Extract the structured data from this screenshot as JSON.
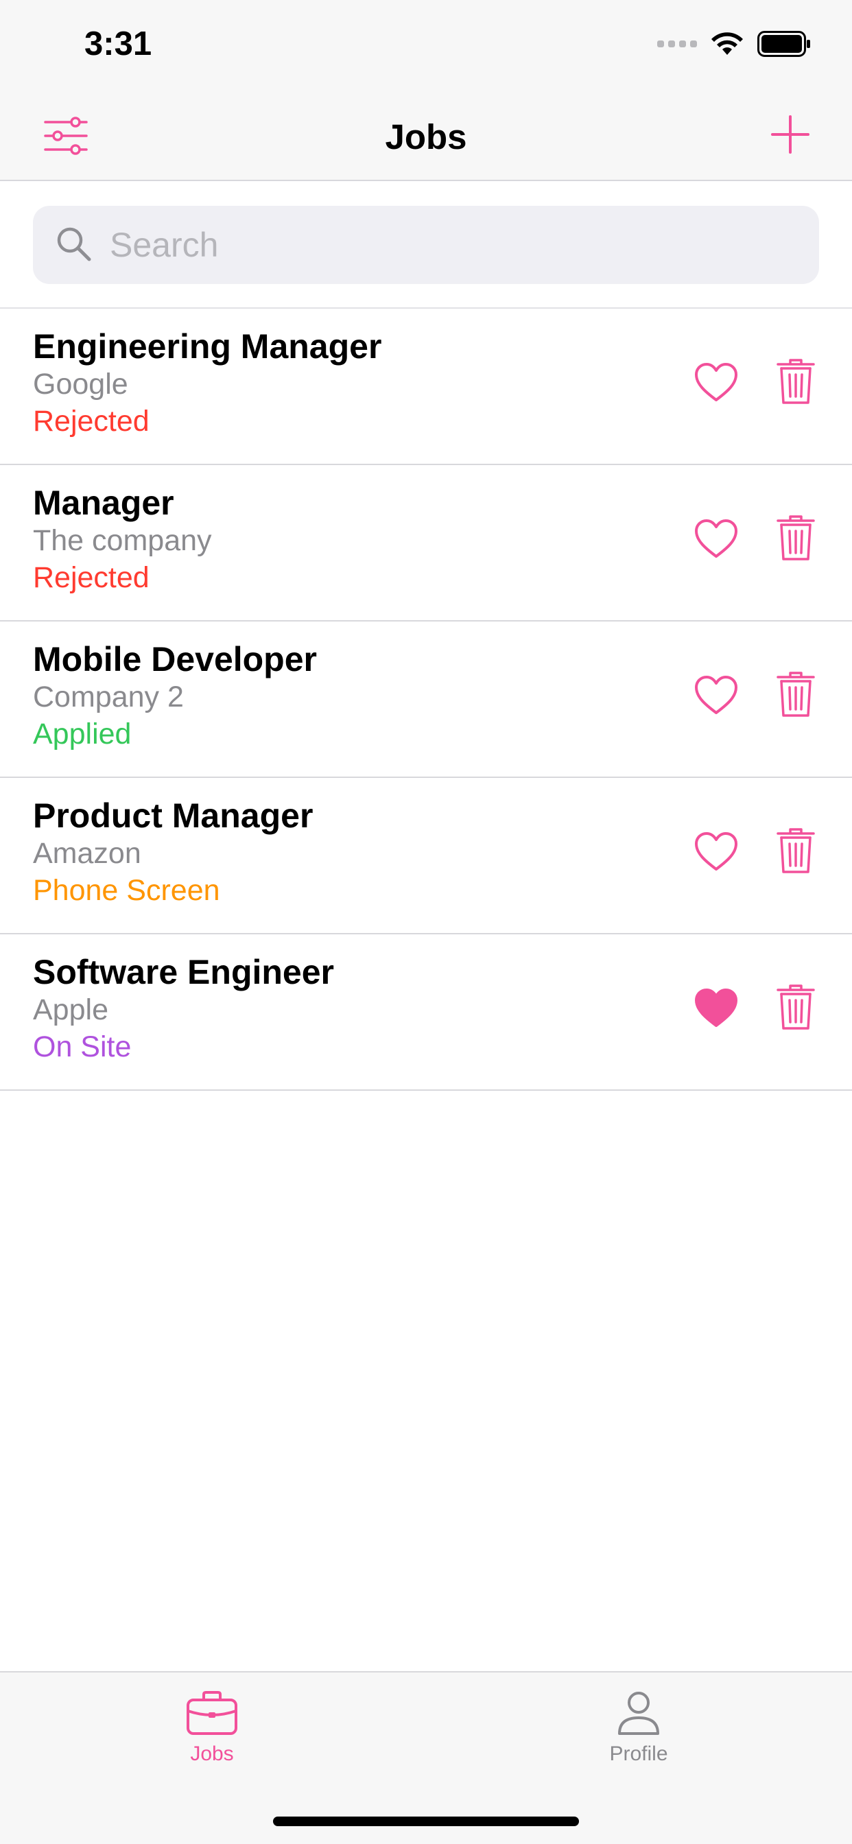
{
  "status_bar": {
    "time": "3:31"
  },
  "nav": {
    "title": "Jobs"
  },
  "search": {
    "placeholder": "Search",
    "value": ""
  },
  "colors": {
    "accent": "#f2509a",
    "rejected": "#ff3b30",
    "applied": "#34c759",
    "phone_screen": "#ff9500",
    "on_site": "#af52de",
    "secondary_text": "#8a8a8e"
  },
  "jobs": [
    {
      "title": "Engineering Manager",
      "company": "Google",
      "status": "Rejected",
      "status_color": "#ff3b30",
      "favorite": false
    },
    {
      "title": "Manager",
      "company": "The company",
      "status": "Rejected",
      "status_color": "#ff3b30",
      "favorite": false
    },
    {
      "title": "Mobile Developer",
      "company": "Company 2",
      "status": "Applied",
      "status_color": "#34c759",
      "favorite": false
    },
    {
      "title": "Product Manager",
      "company": "Amazon",
      "status": "Phone Screen",
      "status_color": "#ff9500",
      "favorite": false
    },
    {
      "title": "Software Engineer",
      "company": "Apple",
      "status": "On Site",
      "status_color": "#af52de",
      "favorite": true
    }
  ],
  "tabs": [
    {
      "label": "Jobs",
      "icon": "briefcase-icon",
      "selected": true
    },
    {
      "label": "Profile",
      "icon": "person-icon",
      "selected": false
    }
  ]
}
